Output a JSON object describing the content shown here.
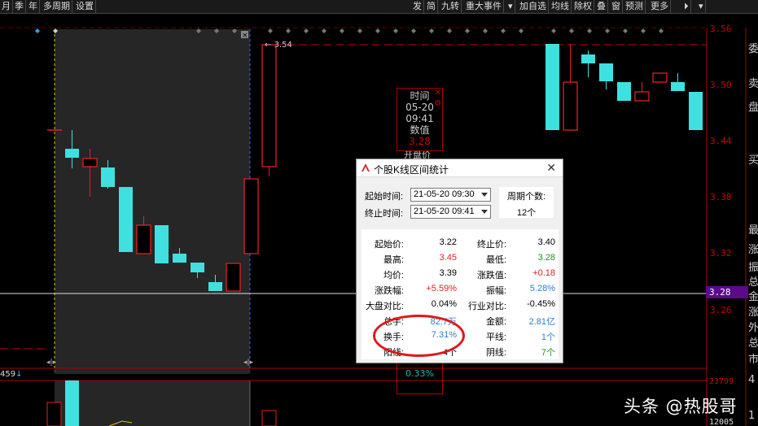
{
  "toolbar": {
    "left_items": [
      "月",
      "季",
      "年",
      "多周期",
      "设置"
    ],
    "right_items": [
      "发",
      "简",
      "九转",
      "重大事件",
      "▾",
      "加自选",
      "均线",
      "除权",
      "叠",
      "窗",
      "预测",
      "更多",
      "⏵",
      "▾"
    ]
  },
  "axis": {
    "prices": [
      "3.56",
      "3.50",
      "3.44",
      "3.38",
      "3.32",
      "3.26"
    ],
    "current_price": "3.28",
    "volume_top": "23799",
    "volume_bottom": "12005",
    "volume_left": "459"
  },
  "chart": {
    "peak_label": "3.54",
    "colors": {
      "up": "#e02020",
      "down": "#40e0e0",
      "selection": "#262626",
      "dash": "#c00000"
    }
  },
  "sidebar_chars": [
    "委",
    "卖",
    "盘",
    "买",
    "最",
    "涨",
    "振",
    "总",
    "金",
    "涨",
    "外",
    "总",
    "市",
    "4",
    "1"
  ],
  "tooltip": {
    "time_label": "时间",
    "date": "05-20",
    "time": "09:41",
    "value_label": "数值",
    "value": "3.28",
    "extra": "开盘价",
    "pct": "0.33%"
  },
  "dialog": {
    "title": "个股K线区间统计",
    "start_label": "起始时间:",
    "start_value": "21-05-20 09:30",
    "end_label": "终止时间:",
    "end_value": "21-05-20 09:41",
    "period_label": "周期个数:",
    "period_value": "12个",
    "stats": [
      {
        "l1": "起始价:",
        "v1": "3.22",
        "c1": "black",
        "l2": "终止价:",
        "v2": "3.40",
        "c2": "black"
      },
      {
        "l1": "最高:",
        "v1": "3.45",
        "c1": "red",
        "l2": "最低:",
        "v2": "3.28",
        "c2": "green"
      },
      {
        "l1": "均价:",
        "v1": "3.39",
        "c1": "black",
        "l2": "涨跌值:",
        "v2": "+0.18",
        "c2": "red"
      },
      {
        "l1": "涨跌幅:",
        "v1": "+5.59%",
        "c1": "red",
        "l2": "振幅:",
        "v2": "5.28%",
        "c2": "blue"
      },
      {
        "l1": "大盘对比:",
        "v1": "0.04%",
        "c1": "black",
        "l2": "行业对比:",
        "v2": "-0.45%",
        "c2": "black"
      },
      {
        "l1": "总手:",
        "v1": "82.7万",
        "c1": "blue",
        "l2": "金额:",
        "v2": "2.81亿",
        "c2": "blue"
      },
      {
        "l1": "换手:",
        "v1": "7.31%",
        "c1": "blue",
        "l2": "平线:",
        "v2": "1个",
        "c2": "blue"
      },
      {
        "l1": "阳线:",
        "v1": "4个",
        "c1": "black",
        "l2": "阴线:",
        "v2": "7个",
        "c2": "green"
      }
    ]
  },
  "watermark": "头条 @热股哥"
}
